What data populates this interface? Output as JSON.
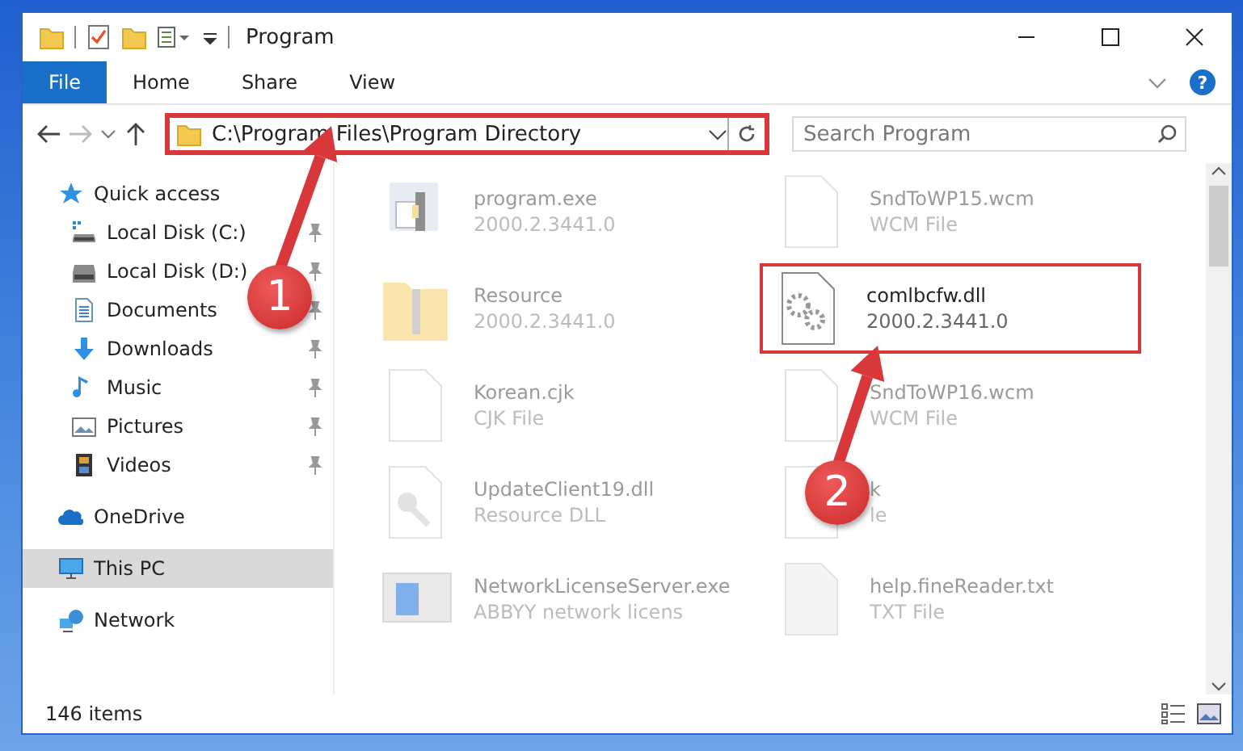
{
  "window": {
    "title": "Program"
  },
  "ribbon_tabs": [
    {
      "label": "File",
      "kind": "file",
      "selected": false
    },
    {
      "label": "Home",
      "kind": "tab",
      "selected": false
    },
    {
      "label": "Share",
      "kind": "tab",
      "selected": false
    },
    {
      "label": "View",
      "kind": "tab",
      "selected": false
    }
  ],
  "address_bar": {
    "path": "C:\\Program Files\\Program Directory",
    "highlighted": true
  },
  "help_button": "?",
  "search": {
    "placeholder": "Search Program"
  },
  "sidebar": {
    "items": [
      {
        "label": "Quick access",
        "kind": "star",
        "selected": false,
        "children": [
          {
            "label": "Local Disk (C:)",
            "kind": "drive-c",
            "selected": false,
            "pinned": true
          },
          {
            "label": "Local Disk (D:)",
            "kind": "drive",
            "selected": false,
            "pinned": true
          },
          {
            "label": "Documents",
            "kind": "document",
            "selected": false,
            "pinned": true
          },
          {
            "label": "Downloads",
            "kind": "download",
            "selected": false,
            "pinned": true
          },
          {
            "label": "Music",
            "kind": "music",
            "selected": false,
            "pinned": true
          },
          {
            "label": "Pictures",
            "kind": "picture",
            "selected": false,
            "pinned": true
          },
          {
            "label": "Videos",
            "kind": "video",
            "selected": false,
            "pinned": true
          }
        ]
      },
      {
        "label": "OneDrive",
        "kind": "cloud",
        "selected": false
      },
      {
        "label": "This PC",
        "kind": "pc",
        "selected": true
      },
      {
        "label": "Network",
        "kind": "network",
        "selected": false
      }
    ]
  },
  "files": [
    {
      "name": "program.exe",
      "detail": "2000.2.3441.0",
      "kind": "exe",
      "dimmed": true,
      "highlighted": false
    },
    {
      "name": "SndToWP15.wcm",
      "detail": "WCM File",
      "kind": "blank",
      "dimmed": true,
      "highlighted": false
    },
    {
      "name": "Resource",
      "detail": "2000.2.3441.0",
      "kind": "folder",
      "dimmed": true,
      "highlighted": false
    },
    {
      "name": "comlbcfw.dll",
      "detail": "2000.2.3441.0",
      "kind": "gear",
      "dimmed": false,
      "highlighted": true
    },
    {
      "name": "Korean.cjk",
      "detail": "CJK File",
      "kind": "blank",
      "dimmed": true,
      "highlighted": false
    },
    {
      "name": "SndToWP16.wcm",
      "detail": "WCM File",
      "kind": "blank",
      "dimmed": true,
      "highlighted": false
    },
    {
      "name": "UpdateClient19.dll",
      "detail": "Resource DLL",
      "kind": "wrench",
      "dimmed": true,
      "highlighted": false
    },
    {
      "name": "k",
      "detail": "le",
      "kind": "blank",
      "dimmed": true,
      "highlighted": false
    },
    {
      "name": "NetworkLicenseServer.exe",
      "detail": "ABBYY network licens",
      "kind": "app",
      "dimmed": true,
      "highlighted": false
    },
    {
      "name": "help.fineReader.txt",
      "detail": "TXT File",
      "kind": "text",
      "dimmed": true,
      "highlighted": false
    }
  ],
  "status_bar": {
    "item_count": "146 items"
  },
  "annotations": [
    {
      "label": "1"
    },
    {
      "label": "2"
    }
  ]
}
